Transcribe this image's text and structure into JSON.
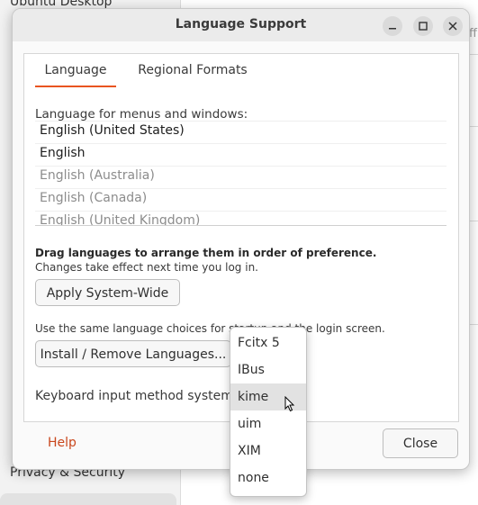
{
  "background": {
    "sidebar_items": [
      "Ubuntu Desktop",
      "Privacy & Security"
    ],
    "right_fragment": "ff"
  },
  "dialog": {
    "title": "Language Support",
    "tabs": [
      {
        "label": "Language",
        "active": true
      },
      {
        "label": "Regional Formats",
        "active": false
      }
    ],
    "language": {
      "heading": "Language for menus and windows:",
      "items": [
        {
          "label": "English (United States)",
          "enabled": true
        },
        {
          "label": "English",
          "enabled": true
        },
        {
          "label": "English (Australia)",
          "enabled": false
        },
        {
          "label": "English (Canada)",
          "enabled": false
        },
        {
          "label": "English (United Kingdom)",
          "enabled": false
        }
      ],
      "drag_hint": "Drag languages to arrange them in order of preference.",
      "drag_note": "Changes take effect next time you log in.",
      "apply_button": "Apply System-Wide",
      "apply_note": "Use the same language choices for startup and the login screen.",
      "install_button": "Install / Remove Languages...",
      "keyboard_label": "Keyboard input method system:"
    },
    "help_link": "Help",
    "close_button": "Close"
  },
  "input_method_menu": {
    "options": [
      "Fcitx 5",
      "IBus",
      "kime",
      "uim",
      "XIM",
      "none"
    ],
    "hovered": "kime"
  },
  "colors": {
    "accent": "#e95420",
    "help_link": "#c9471d"
  }
}
